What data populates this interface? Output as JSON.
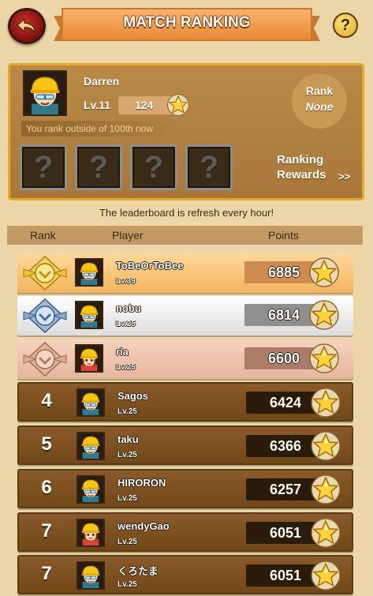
{
  "header": {
    "title": "MATCH RANKING",
    "back_icon": "back-arrow-icon",
    "help_label": "?"
  },
  "player": {
    "name": "Darren",
    "level": "Lv.11",
    "points": "124",
    "status_text": "You rank outside of 100th now",
    "rank_label": "Rank",
    "rank_value": "None",
    "reward_slots": [
      "?",
      "?",
      "?",
      "?"
    ],
    "rewards_label_line1": "Ranking",
    "rewards_label_line2": "Rewards",
    "rewards_arrow": ">>"
  },
  "notice": "The leaderboard is refresh every hour!",
  "table": {
    "col_rank": "Rank",
    "col_player": "Player",
    "col_points": "Points"
  },
  "rows": [
    {
      "rank": "",
      "medal": "gold",
      "name": "ToBeOrToBee",
      "level": "Lv.39",
      "points": "6885",
      "avatar": "boy"
    },
    {
      "rank": "",
      "medal": "silver",
      "name": "nobu",
      "level": "Lv.25",
      "points": "6814",
      "avatar": "boy"
    },
    {
      "rank": "",
      "medal": "bronze",
      "name": "ria",
      "level": "Lv.25",
      "points": "6600",
      "avatar": "girl"
    },
    {
      "rank": "4",
      "medal": "none",
      "name": "Sagos",
      "level": "Lv.25",
      "points": "6424",
      "avatar": "boy"
    },
    {
      "rank": "5",
      "medal": "none",
      "name": "taku",
      "level": "Lv.25",
      "points": "6366",
      "avatar": "boy"
    },
    {
      "rank": "6",
      "medal": "none",
      "name": "HIRORON",
      "level": "Lv.25",
      "points": "6257",
      "avatar": "boy"
    },
    {
      "rank": "7",
      "medal": "none",
      "name": "wendyGao",
      "level": "Lv.25",
      "points": "6051",
      "avatar": "girl"
    },
    {
      "rank": "7",
      "medal": "none",
      "name": "くろたま",
      "level": "Lv.25",
      "points": "6051",
      "avatar": "boy"
    }
  ],
  "colors": {
    "background": "#ecd6a8",
    "panel": "#a8773a",
    "panel_border": "#e6a72a",
    "gold_row": "#f2b45c",
    "silver_row": "#dcdcdc",
    "bronze_row": "#e6b59c",
    "plain_row": "#714818"
  }
}
